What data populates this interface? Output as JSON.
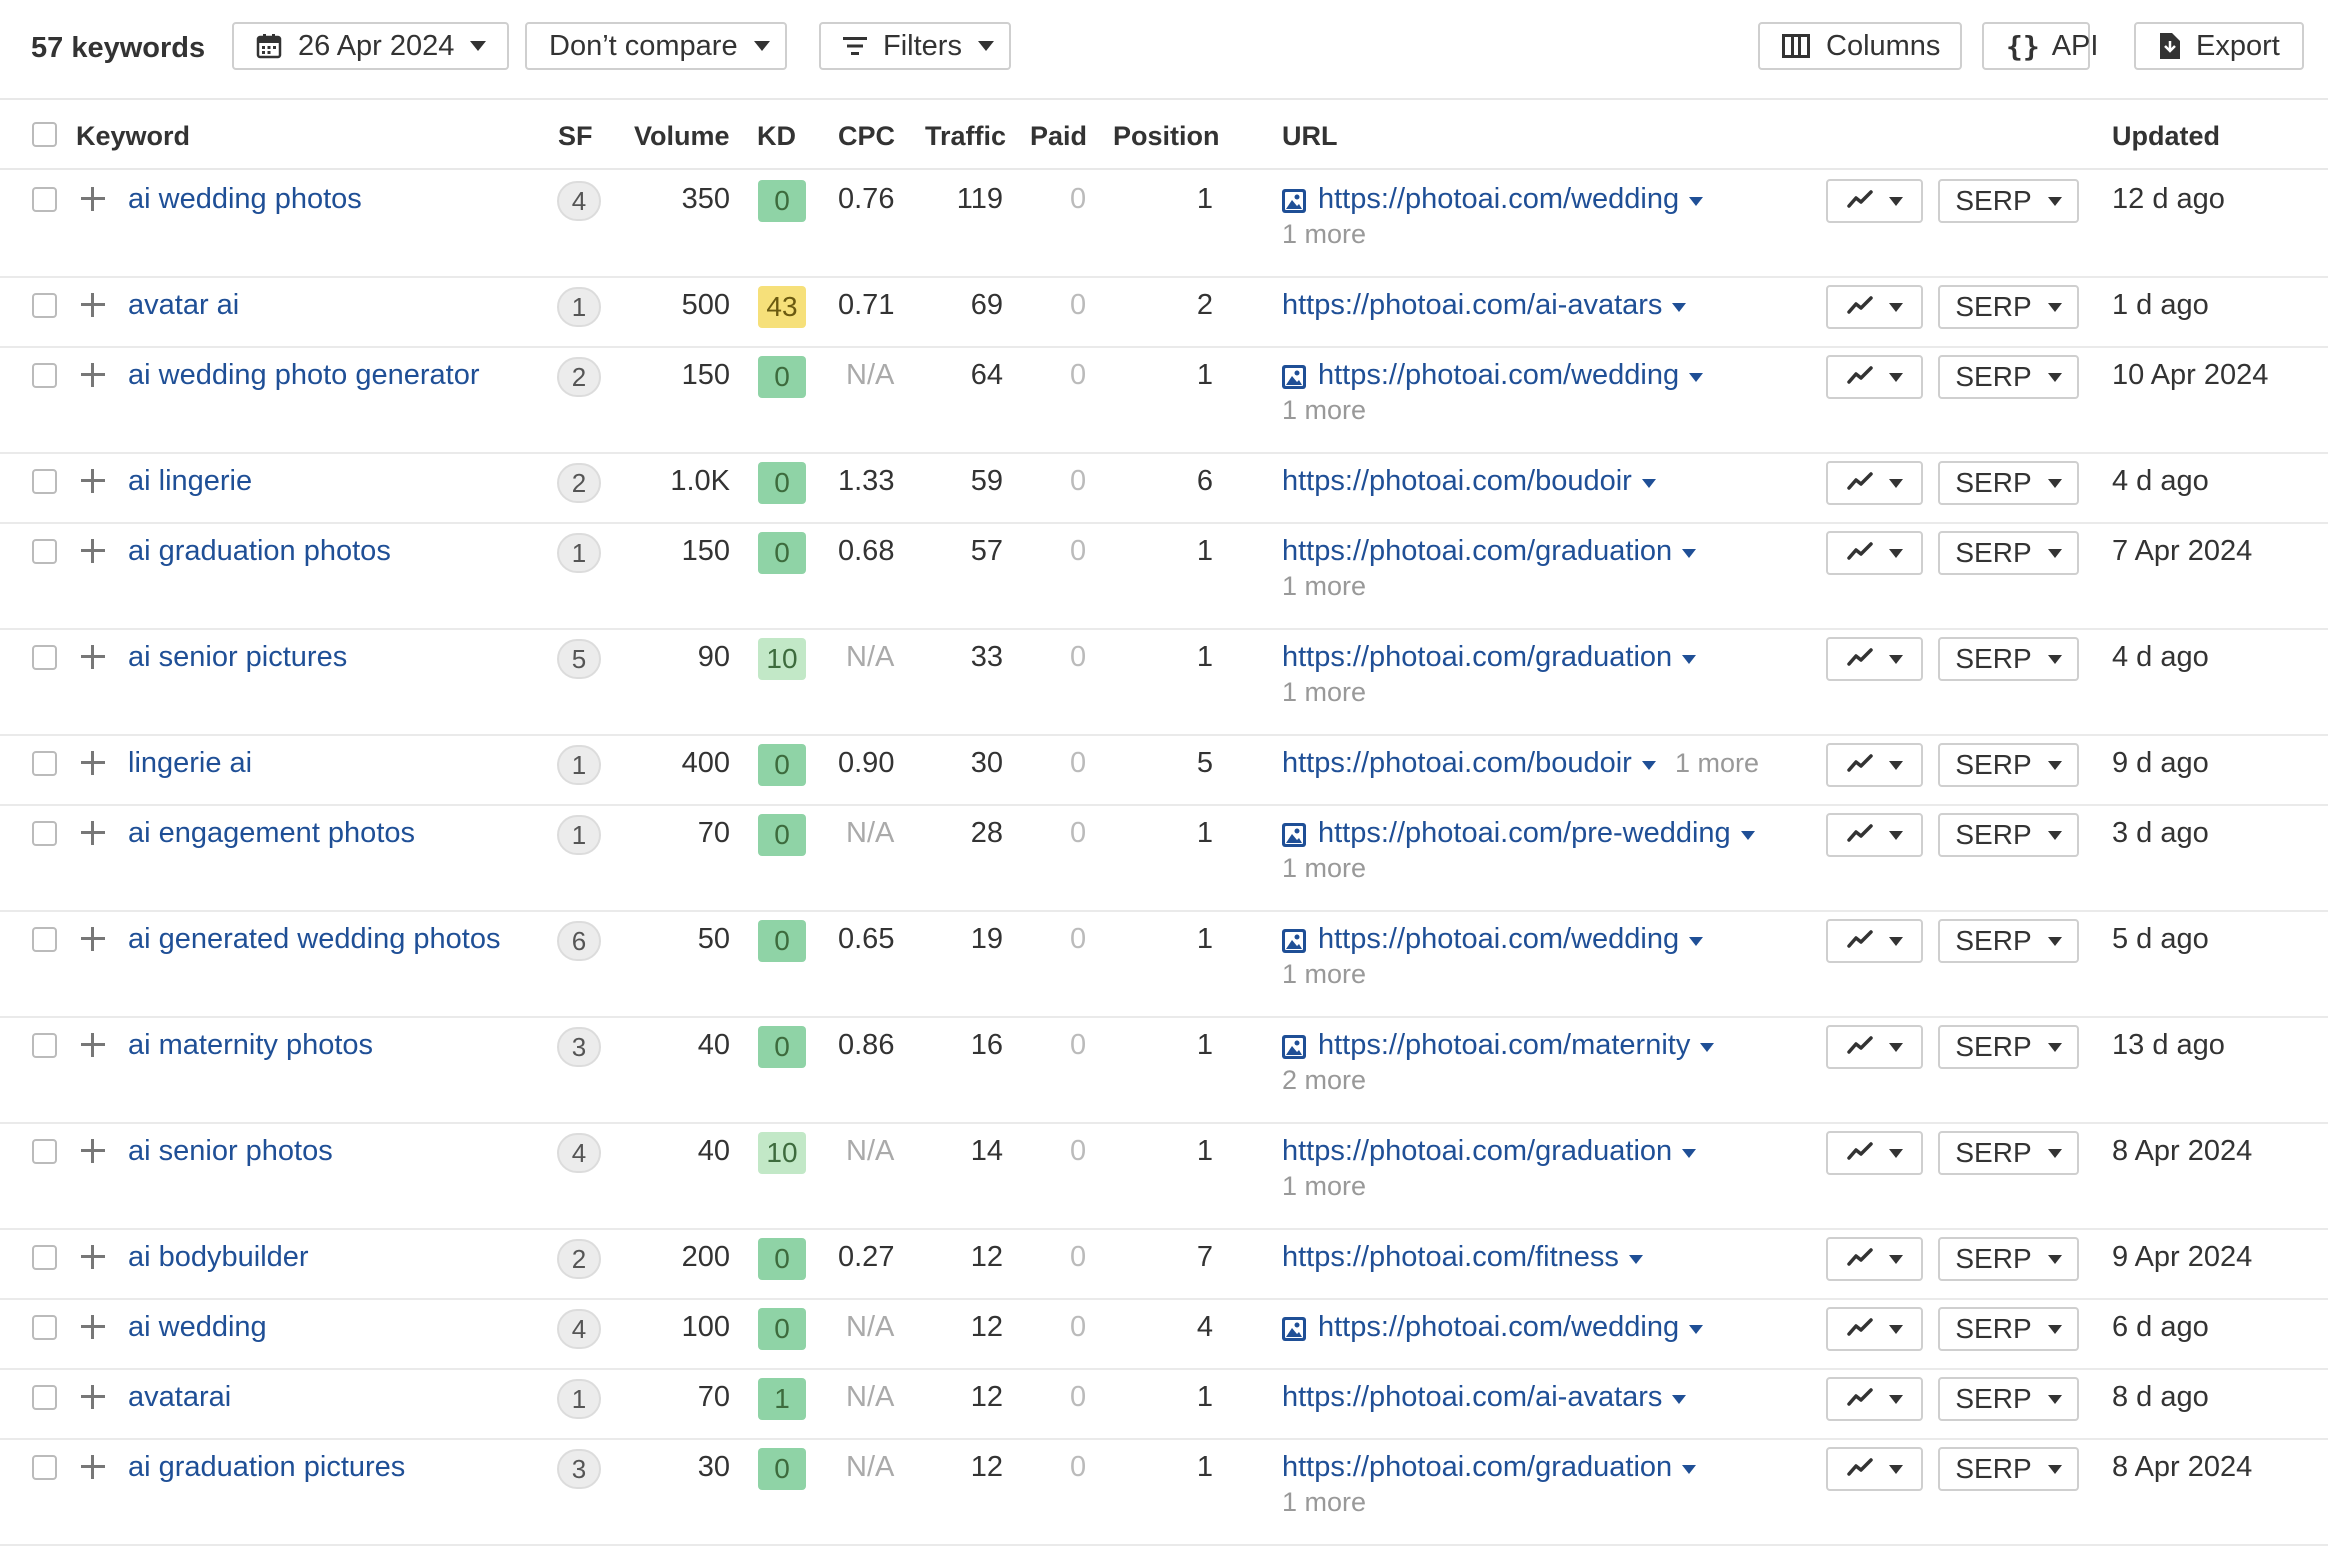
{
  "toolbar": {
    "keyword_count": "57 keywords",
    "date_label": "26 Apr 2024",
    "compare_label": "Don’t compare",
    "filters_label": "Filters",
    "columns_label": "Columns",
    "api_label": "API",
    "export_label": "Export"
  },
  "table": {
    "headers": {
      "keyword": "Keyword",
      "sf": "SF",
      "volume": "Volume",
      "kd": "KD",
      "cpc": "CPC",
      "traffic": "Traffic",
      "paid": "Paid",
      "position": "Position",
      "url": "URL",
      "updated": "Updated"
    },
    "serp_label": "SERP",
    "kd_colors": {
      "green": "#8fd3a6",
      "light_green": "#c2e8c7",
      "yellow": "#f6e07a"
    },
    "rows": [
      {
        "keyword": "ai wedding photos",
        "sf": "4",
        "volume": "350",
        "kd": "0",
        "kd_color": "green",
        "cpc": "0.76",
        "traffic": "119",
        "paid": "0",
        "position": "1",
        "url": "https://photoai.com/wedding",
        "image_icon": true,
        "more": "1 more",
        "updated": "12 d ago"
      },
      {
        "keyword": "avatar ai",
        "sf": "1",
        "volume": "500",
        "kd": "43",
        "kd_color": "yellow",
        "cpc": "0.71",
        "traffic": "69",
        "paid": "0",
        "position": "2",
        "url": "https://photoai.com/ai-avatars",
        "image_icon": false,
        "more": "",
        "updated": "1 d ago"
      },
      {
        "keyword": "ai wedding photo generator",
        "sf": "2",
        "volume": "150",
        "kd": "0",
        "kd_color": "green",
        "cpc": "N/A",
        "traffic": "64",
        "paid": "0",
        "position": "1",
        "url": "https://photoai.com/wedding",
        "image_icon": true,
        "more": "1 more",
        "updated": "10 Apr 2024"
      },
      {
        "keyword": "ai lingerie",
        "sf": "2",
        "volume": "1.0K",
        "kd": "0",
        "kd_color": "green",
        "cpc": "1.33",
        "traffic": "59",
        "paid": "0",
        "position": "6",
        "url": "https://photoai.com/boudoir",
        "image_icon": false,
        "more": "",
        "updated": "4 d ago"
      },
      {
        "keyword": "ai graduation photos",
        "sf": "1",
        "volume": "150",
        "kd": "0",
        "kd_color": "green",
        "cpc": "0.68",
        "traffic": "57",
        "paid": "0",
        "position": "1",
        "url": "https://photoai.com/graduation",
        "image_icon": false,
        "more": "1 more",
        "updated": "7 Apr 2024"
      },
      {
        "keyword": "ai senior pictures",
        "sf": "5",
        "volume": "90",
        "kd": "10",
        "kd_color": "light_green",
        "cpc": "N/A",
        "traffic": "33",
        "paid": "0",
        "position": "1",
        "url": "https://photoai.com/graduation",
        "image_icon": false,
        "more": "1 more",
        "updated": "4 d ago"
      },
      {
        "keyword": "lingerie ai",
        "sf": "1",
        "volume": "400",
        "kd": "0",
        "kd_color": "green",
        "cpc": "0.90",
        "traffic": "30",
        "paid": "0",
        "position": "5",
        "url": "https://photoai.com/boudoir",
        "image_icon": false,
        "more_inline": "1 more",
        "updated": "9 d ago"
      },
      {
        "keyword": "ai engagement photos",
        "sf": "1",
        "volume": "70",
        "kd": "0",
        "kd_color": "green",
        "cpc": "N/A",
        "traffic": "28",
        "paid": "0",
        "position": "1",
        "url": "https://photoai.com/pre-wedding",
        "image_icon": true,
        "more": "1 more",
        "updated": "3 d ago"
      },
      {
        "keyword": "ai generated wedding photos",
        "sf": "6",
        "volume": "50",
        "kd": "0",
        "kd_color": "green",
        "cpc": "0.65",
        "traffic": "19",
        "paid": "0",
        "position": "1",
        "url": "https://photoai.com/wedding",
        "image_icon": true,
        "more": "1 more",
        "updated": "5 d ago"
      },
      {
        "keyword": "ai maternity photos",
        "sf": "3",
        "volume": "40",
        "kd": "0",
        "kd_color": "green",
        "cpc": "0.86",
        "traffic": "16",
        "paid": "0",
        "position": "1",
        "url": "https://photoai.com/maternity",
        "image_icon": true,
        "more": "2 more",
        "updated": "13 d ago"
      },
      {
        "keyword": "ai senior photos",
        "sf": "4",
        "volume": "40",
        "kd": "10",
        "kd_color": "light_green",
        "cpc": "N/A",
        "traffic": "14",
        "paid": "0",
        "position": "1",
        "url": "https://photoai.com/graduation",
        "image_icon": false,
        "more": "1 more",
        "updated": "8 Apr 2024"
      },
      {
        "keyword": "ai bodybuilder",
        "sf": "2",
        "volume": "200",
        "kd": "0",
        "kd_color": "green",
        "cpc": "0.27",
        "traffic": "12",
        "paid": "0",
        "position": "7",
        "url": "https://photoai.com/fitness",
        "image_icon": false,
        "more": "",
        "updated": "9 Apr 2024"
      },
      {
        "keyword": "ai wedding",
        "sf": "4",
        "volume": "100",
        "kd": "0",
        "kd_color": "green",
        "cpc": "N/A",
        "traffic": "12",
        "paid": "0",
        "position": "4",
        "url": "https://photoai.com/wedding",
        "image_icon": true,
        "more": "",
        "updated": "6 d ago"
      },
      {
        "keyword": "avatarai",
        "sf": "1",
        "volume": "70",
        "kd": "1",
        "kd_color": "green",
        "cpc": "N/A",
        "traffic": "12",
        "paid": "0",
        "position": "1",
        "url": "https://photoai.com/ai-avatars",
        "image_icon": false,
        "more": "",
        "updated": "8 d ago"
      },
      {
        "keyword": "ai graduation pictures",
        "sf": "3",
        "volume": "30",
        "kd": "0",
        "kd_color": "green",
        "cpc": "N/A",
        "traffic": "12",
        "paid": "0",
        "position": "1",
        "url": "https://photoai.com/graduation",
        "image_icon": false,
        "more": "1 more",
        "updated": "8 Apr 2024"
      }
    ]
  }
}
